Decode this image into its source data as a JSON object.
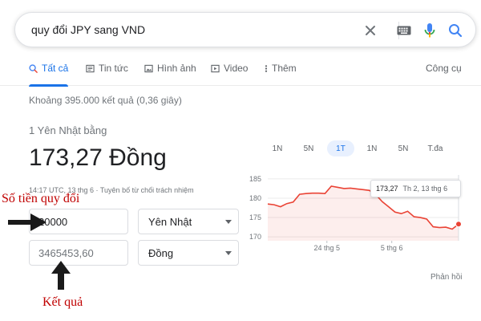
{
  "search": {
    "query": "quy đổi JPY sang VND"
  },
  "icons": {
    "clear": "close-icon",
    "keyboard": "keyboard-icon",
    "voice": "microphone-icon",
    "search": "search-icon"
  },
  "tabs": [
    {
      "label": "Tất cả",
      "icon": "search-icon",
      "active": true
    },
    {
      "label": "Tin tức",
      "icon": "news-icon",
      "active": false
    },
    {
      "label": "Hình ảnh",
      "icon": "image-icon",
      "active": false
    },
    {
      "label": "Video",
      "icon": "video-icon",
      "active": false
    },
    {
      "label": "Thêm",
      "icon": "more-vert-icon",
      "active": false
    }
  ],
  "tools_label": "Công cụ",
  "result_stats": "Khoảng 395.000 kết quả (0,36 giây)",
  "converter": {
    "from_label": "1 Yên Nhật bằng",
    "to_value": "173,27 Đồng",
    "updated": "14:17 UTC, 13 thg 6 · Tuyên bố từ chối trách nhiệm",
    "amount_input": "20000",
    "from_currency": "Yên Nhật",
    "result_value": "3465453,60",
    "to_currency": "Đồng"
  },
  "annotations": {
    "amount_label": "Số tiền quy đổi",
    "result_label": "Kết quả"
  },
  "time_ranges": [
    {
      "label": "1N",
      "active": false
    },
    {
      "label": "5N",
      "active": false
    },
    {
      "label": "1T",
      "active": true
    },
    {
      "label": "1N",
      "active": false
    },
    {
      "label": "5N",
      "active": false
    },
    {
      "label": "T.đa",
      "active": false
    }
  ],
  "tooltip": {
    "value": "173,27",
    "date": "Th 2, 13 thg 6"
  },
  "feedback_label": "Phản hồi",
  "colors": {
    "accent": "#1a73e8",
    "chart_line": "#ea4335",
    "annotation": "#c00000"
  },
  "chart_data": {
    "type": "area",
    "y_ticks": [
      "185",
      "180",
      "175",
      "170"
    ],
    "x_tick_labels": [
      "24 thg 5",
      "5 thg 6"
    ],
    "ylim": [
      169,
      186
    ],
    "x": [
      0,
      1,
      2,
      3,
      4,
      5,
      6,
      7,
      8,
      9,
      10,
      11,
      12,
      13,
      14,
      15,
      16,
      17,
      18,
      19,
      20,
      21,
      22,
      23,
      24,
      25,
      26,
      27,
      28,
      29,
      30
    ],
    "values": [
      178.5,
      178.3,
      177.8,
      178.6,
      179.0,
      181.0,
      181.2,
      181.3,
      181.3,
      181.2,
      183.1,
      182.8,
      182.5,
      182.6,
      182.4,
      182.2,
      182.0,
      180.9,
      179.1,
      177.8,
      176.4,
      176.0,
      176.6,
      175.2,
      175.0,
      174.6,
      172.6,
      172.4,
      172.5,
      172.0,
      173.3
    ],
    "x_tick_positions": [
      9.3,
      19.5
    ],
    "highlight_index": 30,
    "grid": true
  }
}
